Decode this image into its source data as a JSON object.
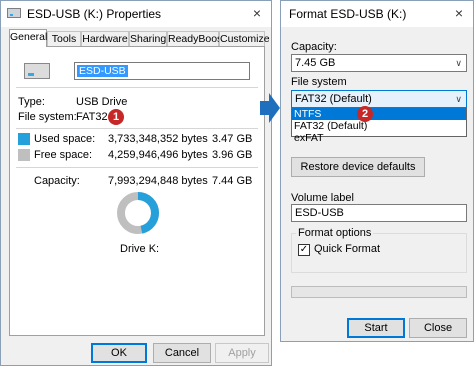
{
  "properties": {
    "title": "ESD-USB (K:) Properties",
    "close": "×",
    "tabs": [
      "General",
      "Tools",
      "Hardware",
      "Sharing",
      "ReadyBoost",
      "Customize"
    ],
    "name_value": "ESD-USB",
    "type_label": "Type:",
    "type_value": "USB Drive",
    "fs_label": "File system:",
    "fs_value": "FAT32",
    "used_label": "Used space:",
    "used_bytes": "3,733,348,352 bytes",
    "used_gb": "3.47 GB",
    "free_label": "Free space:",
    "free_bytes": "4,259,946,496 bytes",
    "free_gb": "3.96 GB",
    "capacity_label": "Capacity:",
    "capacity_bytes": "7,993,294,848 bytes",
    "capacity_gb": "7.44 GB",
    "drive_label": "Drive K:",
    "used_fraction": 0.467,
    "used_color": "#26a0da",
    "free_color": "#bfbfbf",
    "ok": "OK",
    "cancel": "Cancel",
    "apply": "Apply",
    "badge": "1"
  },
  "format": {
    "title": "Format ESD-USB (K:)",
    "close": "×",
    "capacity_label": "Capacity:",
    "capacity_value": "7.45 GB",
    "fs_label": "File system",
    "fs_selected": "FAT32 (Default)",
    "fs_options": [
      "NTFS",
      "FAT32 (Default)",
      "exFAT"
    ],
    "restore": "Restore device defaults",
    "volume_label": "Volume label",
    "volume_value": "ESD-USB",
    "options_title": "Format options",
    "quick_format": "Quick Format",
    "quick_checked": "✓",
    "progress": 0,
    "start": "Start",
    "close_btn": "Close",
    "badge": "2"
  }
}
